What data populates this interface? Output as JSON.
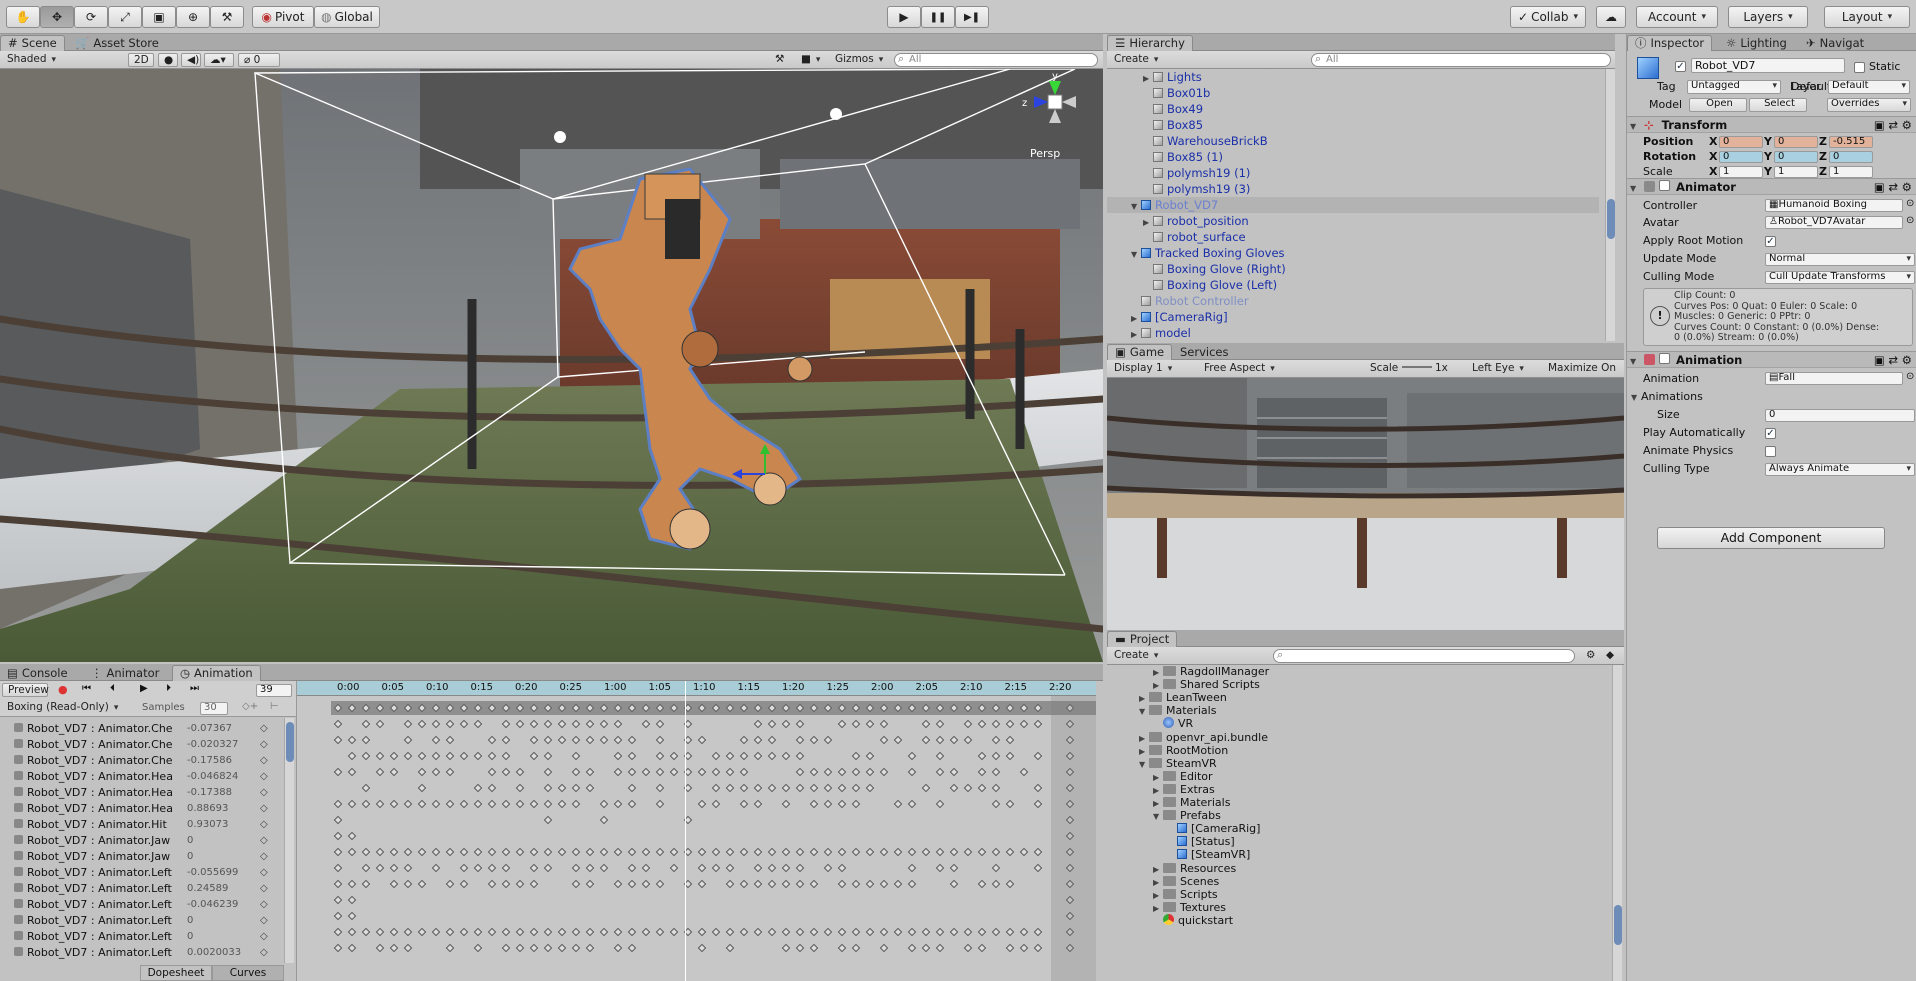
{
  "toolbar": {
    "tools": [
      {
        "name": "hand-tool-icon",
        "glyph": "✋"
      },
      {
        "name": "move-tool-icon",
        "glyph": "✥"
      },
      {
        "name": "rotate-tool-icon",
        "glyph": "⟳"
      },
      {
        "name": "scale-tool-icon",
        "glyph": "⤢"
      },
      {
        "name": "rect-tool-icon",
        "glyph": "▣"
      },
      {
        "name": "transform-tool-icon",
        "glyph": "⊕"
      },
      {
        "name": "custom-tool-icon",
        "glyph": "⚒"
      }
    ],
    "pivot": "Pivot",
    "global": "Global",
    "play": "▶",
    "pause": "❚❚",
    "step": "▶❚",
    "collab": "Collab",
    "account": "Account",
    "layers": "Layers",
    "layout": "Layout"
  },
  "scene": {
    "tabs": [
      "Scene",
      "Asset Store"
    ],
    "shading": "Shaded",
    "mode2d": "2D",
    "gizmos": "Gizmos",
    "search_placeholder": "All",
    "persp": "Persp",
    "hidden_count": "0"
  },
  "hierarchy": {
    "tab": "Hierarchy",
    "create": "Create",
    "search_placeholder": "All",
    "items": [
      {
        "label": "Lights",
        "indent": 2,
        "arrow": "▶",
        "selected": false,
        "color": "#1a2fa8",
        "icon": "cube"
      },
      {
        "label": "Box01b",
        "indent": 2,
        "arrow": "",
        "selected": false,
        "color": "#1a2fa8",
        "icon": "cube"
      },
      {
        "label": "Box49",
        "indent": 2,
        "arrow": "",
        "selected": false,
        "color": "#1a2fa8",
        "icon": "cube"
      },
      {
        "label": "Box85",
        "indent": 2,
        "arrow": "",
        "selected": false,
        "color": "#1a2fa8",
        "icon": "cube"
      },
      {
        "label": "WarehouseBrickB",
        "indent": 2,
        "arrow": "",
        "selected": false,
        "color": "#1a2fa8",
        "icon": "cube"
      },
      {
        "label": "Box85 (1)",
        "indent": 2,
        "arrow": "",
        "selected": false,
        "color": "#1a2fa8",
        "icon": "cube"
      },
      {
        "label": "polymsh19 (1)",
        "indent": 2,
        "arrow": "",
        "selected": false,
        "color": "#1a2fa8",
        "icon": "cube"
      },
      {
        "label": "polymsh19 (3)",
        "indent": 2,
        "arrow": "",
        "selected": false,
        "color": "#1a2fa8",
        "icon": "cube"
      },
      {
        "label": "Robot_VD7",
        "indent": 1,
        "arrow": "▼",
        "selected": true,
        "color": "#6a7fd0",
        "icon": "blue"
      },
      {
        "label": "robot_position",
        "indent": 2,
        "arrow": "▶",
        "selected": false,
        "color": "#1a2fa8",
        "icon": "cube"
      },
      {
        "label": "robot_surface",
        "indent": 2,
        "arrow": "",
        "selected": false,
        "color": "#1a2fa8",
        "icon": "cube"
      },
      {
        "label": "Tracked Boxing Gloves",
        "indent": 1,
        "arrow": "▼",
        "selected": false,
        "color": "#1a2fa8",
        "icon": "blue"
      },
      {
        "label": "Boxing Glove (Right)",
        "indent": 2,
        "arrow": "",
        "selected": false,
        "color": "#1a2fa8",
        "icon": "cube"
      },
      {
        "label": "Boxing Glove (Left)",
        "indent": 2,
        "arrow": "",
        "selected": false,
        "color": "#1a2fa8",
        "icon": "cube"
      },
      {
        "label": "Robot Controller",
        "indent": 1,
        "arrow": "",
        "selected": false,
        "color": "#7f8fc4",
        "icon": "cube"
      },
      {
        "label": "[CameraRig]",
        "indent": 1,
        "arrow": "▶",
        "selected": false,
        "color": "#1a2fa8",
        "icon": "blue"
      },
      {
        "label": "model",
        "indent": 1,
        "arrow": "▶",
        "selected": false,
        "color": "#1a2fa8",
        "icon": "cube"
      }
    ]
  },
  "game": {
    "tabs": [
      "Game",
      "Services"
    ],
    "display": "Display 1",
    "aspect": "Free Aspect",
    "scale_label": "Scale",
    "scale_value": "1x",
    "eye": "Left Eye",
    "maximize": "Maximize On P"
  },
  "project": {
    "tab": "Project",
    "create": "Create",
    "items": [
      {
        "label": "RagdollManager",
        "indent": 3,
        "arrow": "▶",
        "type": "folder"
      },
      {
        "label": "Shared Scripts",
        "indent": 3,
        "arrow": "▶",
        "type": "folder"
      },
      {
        "label": "LeanTween",
        "indent": 2,
        "arrow": "▶",
        "type": "folder"
      },
      {
        "label": "Materials",
        "indent": 2,
        "arrow": "▼",
        "type": "folder"
      },
      {
        "label": "VR",
        "indent": 3,
        "arrow": "",
        "type": "sphere"
      },
      {
        "label": "openvr_api.bundle",
        "indent": 2,
        "arrow": "▶",
        "type": "folder"
      },
      {
        "label": "RootMotion",
        "indent": 2,
        "arrow": "▶",
        "type": "folder"
      },
      {
        "label": "SteamVR",
        "indent": 2,
        "arrow": "▼",
        "type": "folder"
      },
      {
        "label": "Editor",
        "indent": 3,
        "arrow": "▶",
        "type": "folder"
      },
      {
        "label": "Extras",
        "indent": 3,
        "arrow": "▶",
        "type": "folder"
      },
      {
        "label": "Materials",
        "indent": 3,
        "arrow": "▶",
        "type": "folder"
      },
      {
        "label": "Prefabs",
        "indent": 3,
        "arrow": "▼",
        "type": "folder"
      },
      {
        "label": "[CameraRig]",
        "indent": 4,
        "arrow": "",
        "type": "prefab"
      },
      {
        "label": "[Status]",
        "indent": 4,
        "arrow": "",
        "type": "prefab"
      },
      {
        "label": "[SteamVR]",
        "indent": 4,
        "arrow": "",
        "type": "prefab"
      },
      {
        "label": "Resources",
        "indent": 3,
        "arrow": "▶",
        "type": "folder"
      },
      {
        "label": "Scenes",
        "indent": 3,
        "arrow": "▶",
        "type": "folder"
      },
      {
        "label": "Scripts",
        "indent": 3,
        "arrow": "▶",
        "type": "folder"
      },
      {
        "label": "Textures",
        "indent": 3,
        "arrow": "▶",
        "type": "folder"
      },
      {
        "label": "quickstart",
        "indent": 3,
        "arrow": "",
        "type": "chrome"
      }
    ]
  },
  "inspector": {
    "tabs": [
      "Inspector",
      "Lighting",
      "Navigat"
    ],
    "object_name": "Robot_VD7",
    "static_label": "Static",
    "tag_label": "Tag",
    "tag_value": "Untagged",
    "layer_label": "Layer",
    "layer_value": "Default",
    "model_label": "Model",
    "open": "Open",
    "select": "Select",
    "overrides": "Overrides",
    "transform": {
      "title": "Transform",
      "rows": [
        {
          "label": "Position",
          "x": "0",
          "y": "0",
          "z": "-0.515",
          "highlight": "#e3b29a"
        },
        {
          "label": "Rotation",
          "x": "0",
          "y": "0",
          "z": "0",
          "highlight": "#a8d0e0"
        },
        {
          "label": "Scale",
          "x": "1",
          "y": "1",
          "z": "1",
          "highlight": "#f3f3f3"
        }
      ]
    },
    "animator": {
      "title": "Animator",
      "controller_label": "Controller",
      "controller_value": "Humanoid Boxing",
      "avatar_label": "Avatar",
      "avatar_value": "Robot_VD7Avatar",
      "apply_root_label": "Apply Root Motion",
      "update_mode_label": "Update Mode",
      "update_mode_value": "Normal",
      "culling_mode_label": "Culling Mode",
      "culling_mode_value": "Cull Update Transforms",
      "info": [
        "Clip Count: 0",
        "Curves Pos: 0 Quat: 0 Euler: 0 Scale: 0",
        "Muscles: 0 Generic: 0 PPtr: 0",
        "Curves Count: 0 Constant: 0 (0.0%) Dense:",
        "0 (0.0%) Stream: 0 (0.0%)"
      ]
    },
    "animation": {
      "title": "Animation",
      "animation_label": "Animation",
      "animation_value": "Fall",
      "animations_label": "Animations",
      "size_label": "Size",
      "size_value": "0",
      "play_auto_label": "Play Automatically",
      "animate_physics_label": "Animate Physics",
      "culling_type_label": "Culling Type",
      "culling_type_value": "Always Animate"
    },
    "add_component": "Add Component"
  },
  "animation_window": {
    "tabs": [
      "Console",
      "Animator",
      "Animation"
    ],
    "preview": "Preview",
    "frame": "39",
    "clip": "Boxing (Read-Only)",
    "samples_label": "Samples",
    "samples_value": "30",
    "dopesheet": "Dopesheet",
    "curves": "Curves",
    "time_labels": [
      "0:00",
      "0:05",
      "0:10",
      "0:15",
      "0:20",
      "0:25",
      "1:00",
      "1:05",
      "1:10",
      "1:15",
      "1:20",
      "1:25",
      "2:00",
      "2:05",
      "2:10",
      "2:15",
      "2:20"
    ],
    "properties": [
      {
        "label": "Robot_VD7 : Animator.Che",
        "value": "-0.07367"
      },
      {
        "label": "Robot_VD7 : Animator.Che",
        "value": "-0.020327"
      },
      {
        "label": "Robot_VD7 : Animator.Che",
        "value": "-0.17586"
      },
      {
        "label": "Robot_VD7 : Animator.Hea",
        "value": "-0.046824"
      },
      {
        "label": "Robot_VD7 : Animator.Hea",
        "value": "-0.17388"
      },
      {
        "label": "Robot_VD7 : Animator.Hea",
        "value": "0.88693"
      },
      {
        "label": "Robot_VD7 : Animator.Hit",
        "value": "0.93073"
      },
      {
        "label": "Robot_VD7 : Animator.Jaw",
        "value": "0"
      },
      {
        "label": "Robot_VD7 : Animator.Jaw",
        "value": "0"
      },
      {
        "label": "Robot_VD7 : Animator.Left",
        "value": "-0.055699"
      },
      {
        "label": "Robot_VD7 : Animator.Left",
        "value": "0.24589"
      },
      {
        "label": "Robot_VD7 : Animator.Left",
        "value": "-0.046239"
      },
      {
        "label": "Robot_VD7 : Animator.Left",
        "value": "0"
      },
      {
        "label": "Robot_VD7 : Animator.Left",
        "value": "0"
      },
      {
        "label": "Robot_VD7 : Animator.Left",
        "value": "0.0020033"
      }
    ]
  }
}
